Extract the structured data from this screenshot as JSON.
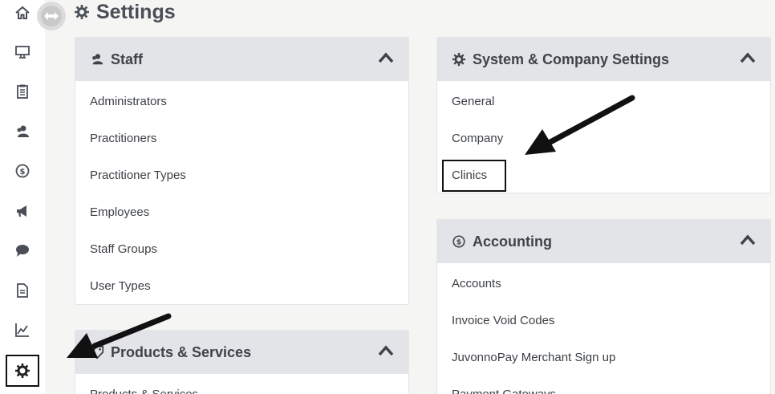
{
  "page": {
    "title": "Settings"
  },
  "sidebar": {
    "items": [
      {
        "name": "home-icon"
      },
      {
        "name": "monitor-icon"
      },
      {
        "name": "clipboard-icon"
      },
      {
        "name": "users-icon"
      },
      {
        "name": "dollar-circle-icon"
      },
      {
        "name": "megaphone-icon"
      },
      {
        "name": "chat-bubble-icon"
      },
      {
        "name": "document-icon"
      },
      {
        "name": "line-chart-icon"
      },
      {
        "name": "gear-icon",
        "active": true
      }
    ]
  },
  "panels": {
    "staff": {
      "title": "Staff",
      "items": [
        "Administrators",
        "Practitioners",
        "Practitioner Types",
        "Employees",
        "Staff Groups",
        "User Types"
      ]
    },
    "system": {
      "title": "System & Company Settings",
      "items": [
        "General",
        "Company",
        "Clinics"
      ]
    },
    "accounting": {
      "title": "Accounting",
      "items": [
        "Accounts",
        "Invoice Void Codes",
        "JuvonnoPay Merchant Sign up",
        "Payment Gateways"
      ]
    },
    "products": {
      "title": "Products & Services",
      "items": [
        "Products & Services"
      ]
    }
  },
  "colors": {
    "panel_header": "#e2e4e8",
    "icon": "#4a4f57",
    "annotation": "#111111"
  }
}
